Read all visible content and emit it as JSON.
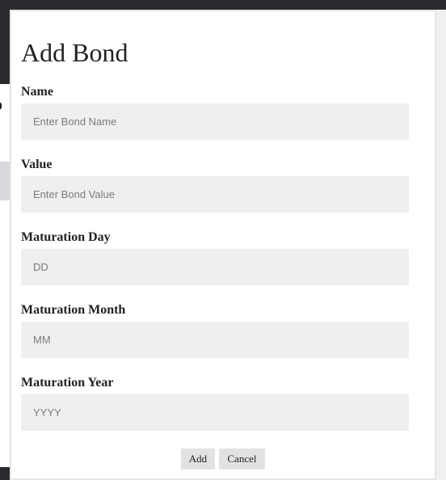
{
  "background": {
    "partial_text": "o"
  },
  "modal": {
    "title": "Add Bond",
    "fields": [
      {
        "label": "Name",
        "placeholder": "Enter Bond Name",
        "value": ""
      },
      {
        "label": "Value",
        "placeholder": "Enter Bond Value",
        "value": ""
      },
      {
        "label": "Maturation Day",
        "placeholder": "DD",
        "value": ""
      },
      {
        "label": "Maturation Month",
        "placeholder": "MM",
        "value": ""
      },
      {
        "label": "Maturation Year",
        "placeholder": "YYYY",
        "value": ""
      }
    ],
    "buttons": {
      "add_label": "Add",
      "cancel_label": "Cancel"
    }
  }
}
